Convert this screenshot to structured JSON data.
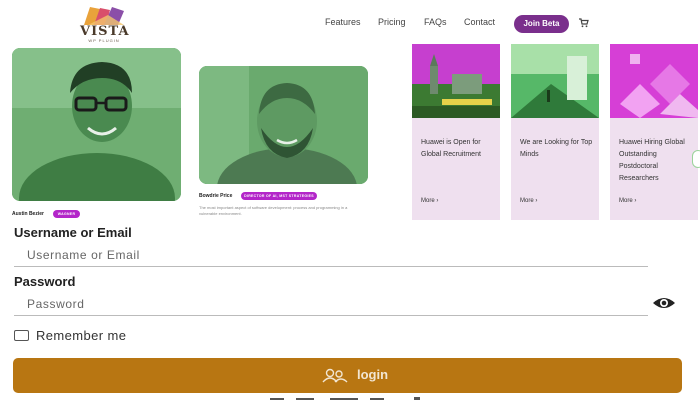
{
  "header": {
    "logo_text": "VISTA",
    "logo_sub": "WP PLUGIN",
    "nav": [
      "Features",
      "Pricing",
      "FAQs",
      "Contact"
    ],
    "join_label": "Join Beta",
    "cart_icon": "cart-icon"
  },
  "people": [
    {
      "name": "Austin Bezier",
      "tag": "WAGNER"
    },
    {
      "name": "Bowdrie Price",
      "tag": "DIRECTOR OF AI, MST STRATEGIES",
      "desc": "The most important aspect of software development: process and programming in a vulnerable environment."
    }
  ],
  "news": [
    {
      "title": "Huawei is Open for Global Recruitment",
      "more": "More"
    },
    {
      "title": "We are Looking for Top Minds",
      "more": "More"
    },
    {
      "title": "Huawei Hiring Global Outstanding Postdoctoral Researchers",
      "more": "More"
    }
  ],
  "form": {
    "username_label": "Username or Email",
    "username_placeholder": "Username or Email",
    "password_label": "Password",
    "password_placeholder": "Password",
    "remember_label": "Remember me",
    "login_label": "login",
    "eye_icon": "eye-icon",
    "login_icon": "users-icon"
  },
  "colors": {
    "accent_purple": "#7a2f8c",
    "tag_magenta": "#b326c9",
    "login_gold": "#b87612",
    "news_card_bg": "#efe0ef"
  }
}
